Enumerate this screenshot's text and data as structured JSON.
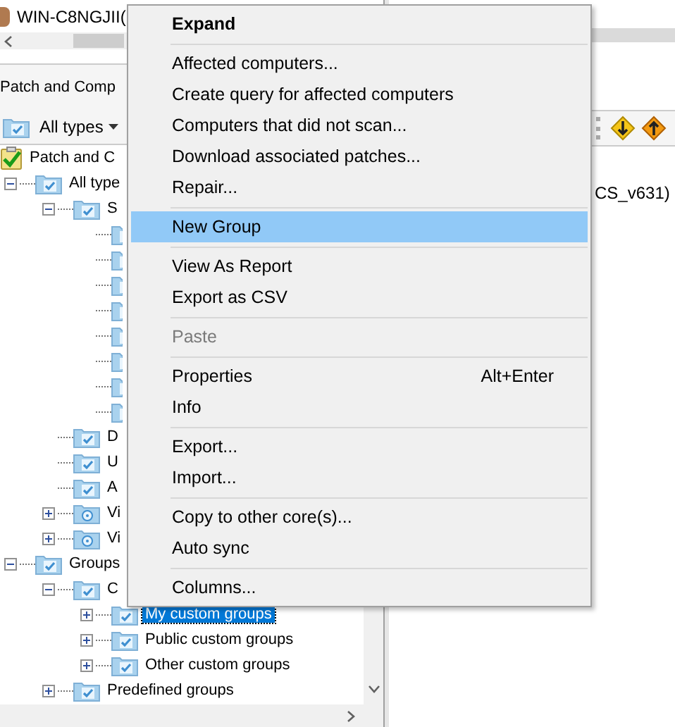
{
  "window": {
    "title": "WIN-C8NGJII("
  },
  "left_panel": {
    "title": "Patch and Comp",
    "filter": "All types",
    "tree": [
      {
        "label": "Patch and C",
        "kind": "root",
        "selected": false,
        "children": [
          {
            "label": "All type",
            "kind": "folder",
            "expanded": true,
            "selected": false,
            "children": [
              {
                "label": "S",
                "kind": "folder",
                "expanded": true,
                "selected": false,
                "children": [
                  {
                    "selected": false
                  },
                  {
                    "selected": false
                  },
                  {
                    "selected": false
                  },
                  {
                    "selected": false
                  },
                  {
                    "selected": false
                  },
                  {
                    "selected": false
                  },
                  {
                    "selected": false
                  },
                  {
                    "selected": false
                  }
                ]
              },
              {
                "label": "D",
                "kind": "folder",
                "selected": false
              },
              {
                "label": "U",
                "kind": "folder",
                "selected": false
              },
              {
                "label": "A",
                "kind": "folder",
                "selected": false
              },
              {
                "label": "Vi",
                "kind": "special",
                "expanded": false,
                "selected": false
              },
              {
                "label": "Vi",
                "kind": "special",
                "expanded": false,
                "selected": false
              }
            ]
          },
          {
            "label": "Groups",
            "kind": "folder",
            "expanded": true,
            "selected": false,
            "children": [
              {
                "label": "C",
                "kind": "folder",
                "expanded": true,
                "selected": false,
                "children": [
                  {
                    "label": "My custom groups",
                    "kind": "folder",
                    "expanded": false,
                    "selected": true
                  },
                  {
                    "label": "Public custom groups",
                    "kind": "folder",
                    "expanded": false,
                    "selected": false
                  },
                  {
                    "label": "Other custom groups",
                    "kind": "folder",
                    "expanded": false,
                    "selected": false
                  }
                ]
              },
              {
                "label": "Predefined groups",
                "kind": "folder",
                "expanded": false,
                "selected": false
              }
            ]
          }
        ]
      }
    ]
  },
  "right_panel": {
    "text": "CS_v631)"
  },
  "context_menu": [
    {
      "kind": "item",
      "label": "Expand",
      "bold": true,
      "selected": false,
      "disabled": false
    },
    {
      "kind": "separator"
    },
    {
      "kind": "item",
      "label": "Affected computers...",
      "selected": false,
      "disabled": false
    },
    {
      "kind": "item",
      "label": "Create query for affected computers",
      "selected": false,
      "disabled": false
    },
    {
      "kind": "item",
      "label": "Computers that did not scan...",
      "selected": false,
      "disabled": false
    },
    {
      "kind": "item",
      "label": "Download associated patches...",
      "selected": false,
      "disabled": false
    },
    {
      "kind": "item",
      "label": "Repair...",
      "selected": false,
      "disabled": false
    },
    {
      "kind": "separator"
    },
    {
      "kind": "item",
      "label": "New Group",
      "selected": true,
      "disabled": false
    },
    {
      "kind": "separator"
    },
    {
      "kind": "item",
      "label": "View As Report",
      "selected": false,
      "disabled": false
    },
    {
      "kind": "item",
      "label": "Export as CSV",
      "selected": false,
      "disabled": false
    },
    {
      "kind": "separator"
    },
    {
      "kind": "item",
      "label": "Paste",
      "selected": false,
      "disabled": true
    },
    {
      "kind": "separator"
    },
    {
      "kind": "item",
      "label": "Properties",
      "shortcut": "Alt+Enter",
      "selected": false,
      "disabled": false
    },
    {
      "kind": "item",
      "label": "Info",
      "selected": false,
      "disabled": false
    },
    {
      "kind": "separator"
    },
    {
      "kind": "item",
      "label": "Export...",
      "selected": false,
      "disabled": false
    },
    {
      "kind": "item",
      "label": "Import...",
      "selected": false,
      "disabled": false
    },
    {
      "kind": "separator"
    },
    {
      "kind": "item",
      "label": "Copy to other core(s)...",
      "selected": false,
      "disabled": false
    },
    {
      "kind": "item",
      "label": "Auto sync",
      "selected": false,
      "disabled": false
    },
    {
      "kind": "separator"
    },
    {
      "kind": "item",
      "label": "Columns...",
      "selected": false,
      "disabled": false
    }
  ]
}
